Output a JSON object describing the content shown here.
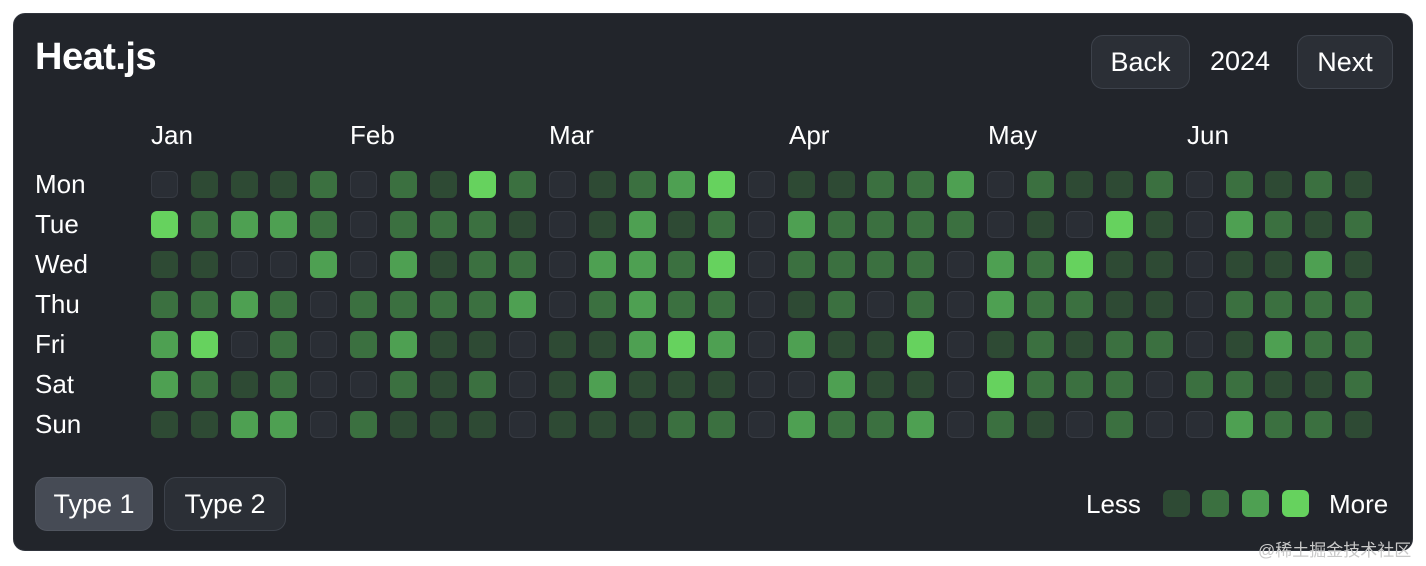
{
  "app": {
    "title": "Heat.js"
  },
  "nav": {
    "back_label": "Back",
    "year": "2024",
    "next_label": "Next"
  },
  "months": [
    "Jan",
    "Feb",
    "Mar",
    "Apr",
    "May",
    "Jun"
  ],
  "days": [
    "Mon",
    "Tue",
    "Wed",
    "Thu",
    "Fri",
    "Sat",
    "Sun"
  ],
  "heatmap_levels": [
    [
      "Mon",
      [
        0,
        1,
        1,
        1,
        2,
        0,
        2,
        1,
        4,
        2,
        0,
        1,
        2,
        3,
        4,
        0,
        1,
        1,
        2,
        2,
        3,
        0,
        2,
        1,
        1,
        2,
        0,
        2,
        1,
        2,
        1
      ]
    ],
    [
      "Tue",
      [
        4,
        2,
        3,
        3,
        2,
        0,
        2,
        2,
        2,
        1,
        0,
        1,
        3,
        1,
        2,
        0,
        3,
        2,
        2,
        2,
        2,
        0,
        1,
        0,
        4,
        1,
        0,
        3,
        2,
        1,
        2
      ]
    ],
    [
      "Wed",
      [
        1,
        1,
        0,
        0,
        3,
        0,
        3,
        1,
        2,
        2,
        0,
        3,
        3,
        2,
        4,
        0,
        2,
        2,
        2,
        2,
        0,
        3,
        2,
        4,
        1,
        1,
        0,
        1,
        1,
        3,
        1
      ]
    ],
    [
      "Thu",
      [
        2,
        2,
        3,
        2,
        0,
        2,
        2,
        2,
        2,
        3,
        0,
        2,
        3,
        2,
        2,
        0,
        1,
        2,
        0,
        2,
        0,
        3,
        2,
        2,
        1,
        1,
        0,
        2,
        2,
        2,
        2
      ]
    ],
    [
      "Fri",
      [
        3,
        4,
        0,
        2,
        0,
        2,
        3,
        1,
        1,
        0,
        1,
        1,
        3,
        4,
        3,
        0,
        3,
        1,
        1,
        4,
        0,
        1,
        2,
        1,
        2,
        2,
        0,
        1,
        3,
        2,
        2
      ]
    ],
    [
      "Sat",
      [
        3,
        2,
        1,
        2,
        0,
        0,
        2,
        1,
        2,
        0,
        1,
        3,
        1,
        1,
        1,
        0,
        0,
        3,
        1,
        1,
        0,
        4,
        2,
        2,
        2,
        0,
        2,
        2,
        1,
        1,
        2
      ]
    ],
    [
      "Sun",
      [
        1,
        1,
        3,
        3,
        0,
        2,
        1,
        1,
        1,
        0,
        1,
        1,
        1,
        2,
        2,
        0,
        3,
        2,
        2,
        3,
        0,
        2,
        1,
        0,
        2,
        0,
        0,
        3,
        2,
        2,
        1
      ]
    ]
  ],
  "level_colors": [
    "#2a2e35",
    "#2e4a34",
    "#3b7040",
    "#4ea052",
    "#66d25e"
  ],
  "type_buttons": [
    "Type 1",
    "Type 2"
  ],
  "legend": {
    "less_label": "Less",
    "more_label": "More"
  }
}
